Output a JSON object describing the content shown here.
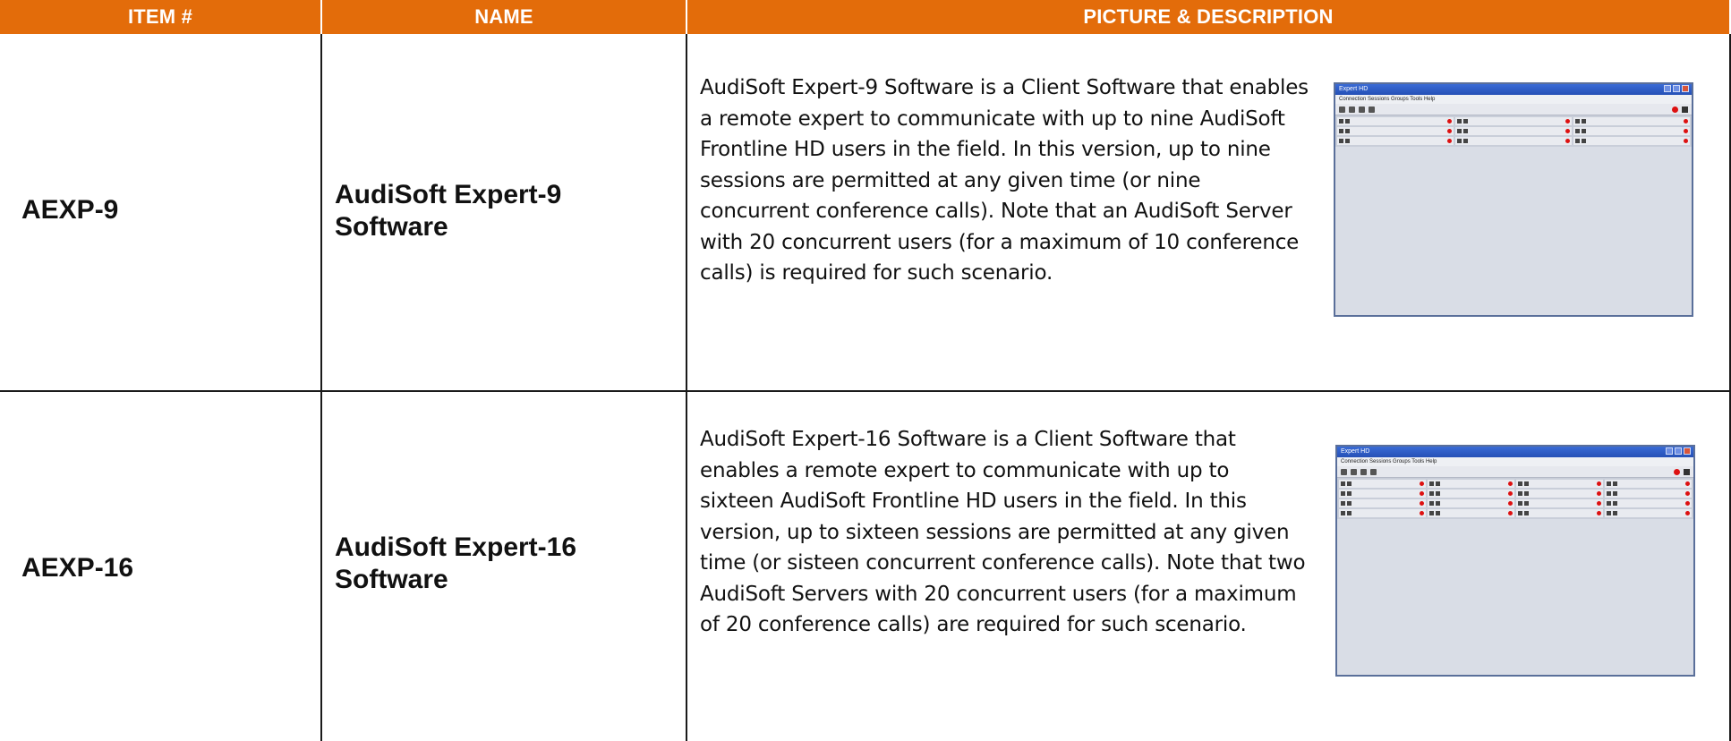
{
  "table": {
    "headers": {
      "item": "ITEM #",
      "name": "NAME",
      "description": "PICTURE & DESCRIPTION"
    },
    "rows": [
      {
        "item": "AEXP-9",
        "name": "AudiSoft Expert-9 Software",
        "description": "AudiSoft Expert-9 Software is a Client Software that enables a remote expert to communicate with up to nine AudiSoft Frontline HD users in the field.  In this version, up to nine sessions are permitted at any given time (or nine concurrent conference calls).  Note that an AudiSoft Server with 20 concurrent users (for a maximum of 10 conference calls) is required for such scenario.",
        "screenshot": {
          "window_title": "Expert HD",
          "menu": "Connection  Sessions  Groups  Tools  Help",
          "grid": "3x3"
        }
      },
      {
        "item": "AEXP-16",
        "name": "AudiSoft Expert-16 Software",
        "description": "AudiSoft Expert-16 Software is a Client Software that enables a remote expert to communicate with up to sixteen AudiSoft Frontline HD users in the field.  In this version, up to sixteen sessions are permitted at any given time (or sisteen concurrent conference calls). Note that two AudiSoft Servers with 20 concurrent users (for a maximum of 20 conference calls) are required for such scenario.",
        "screenshot": {
          "window_title": "Expert HD",
          "menu": "Connection  Sessions  Groups  Tools  Help",
          "grid": "4x4"
        }
      }
    ]
  },
  "colors": {
    "header_bg": "#e36c0a",
    "header_text": "#ffffff",
    "border": "#1a1a1a"
  }
}
